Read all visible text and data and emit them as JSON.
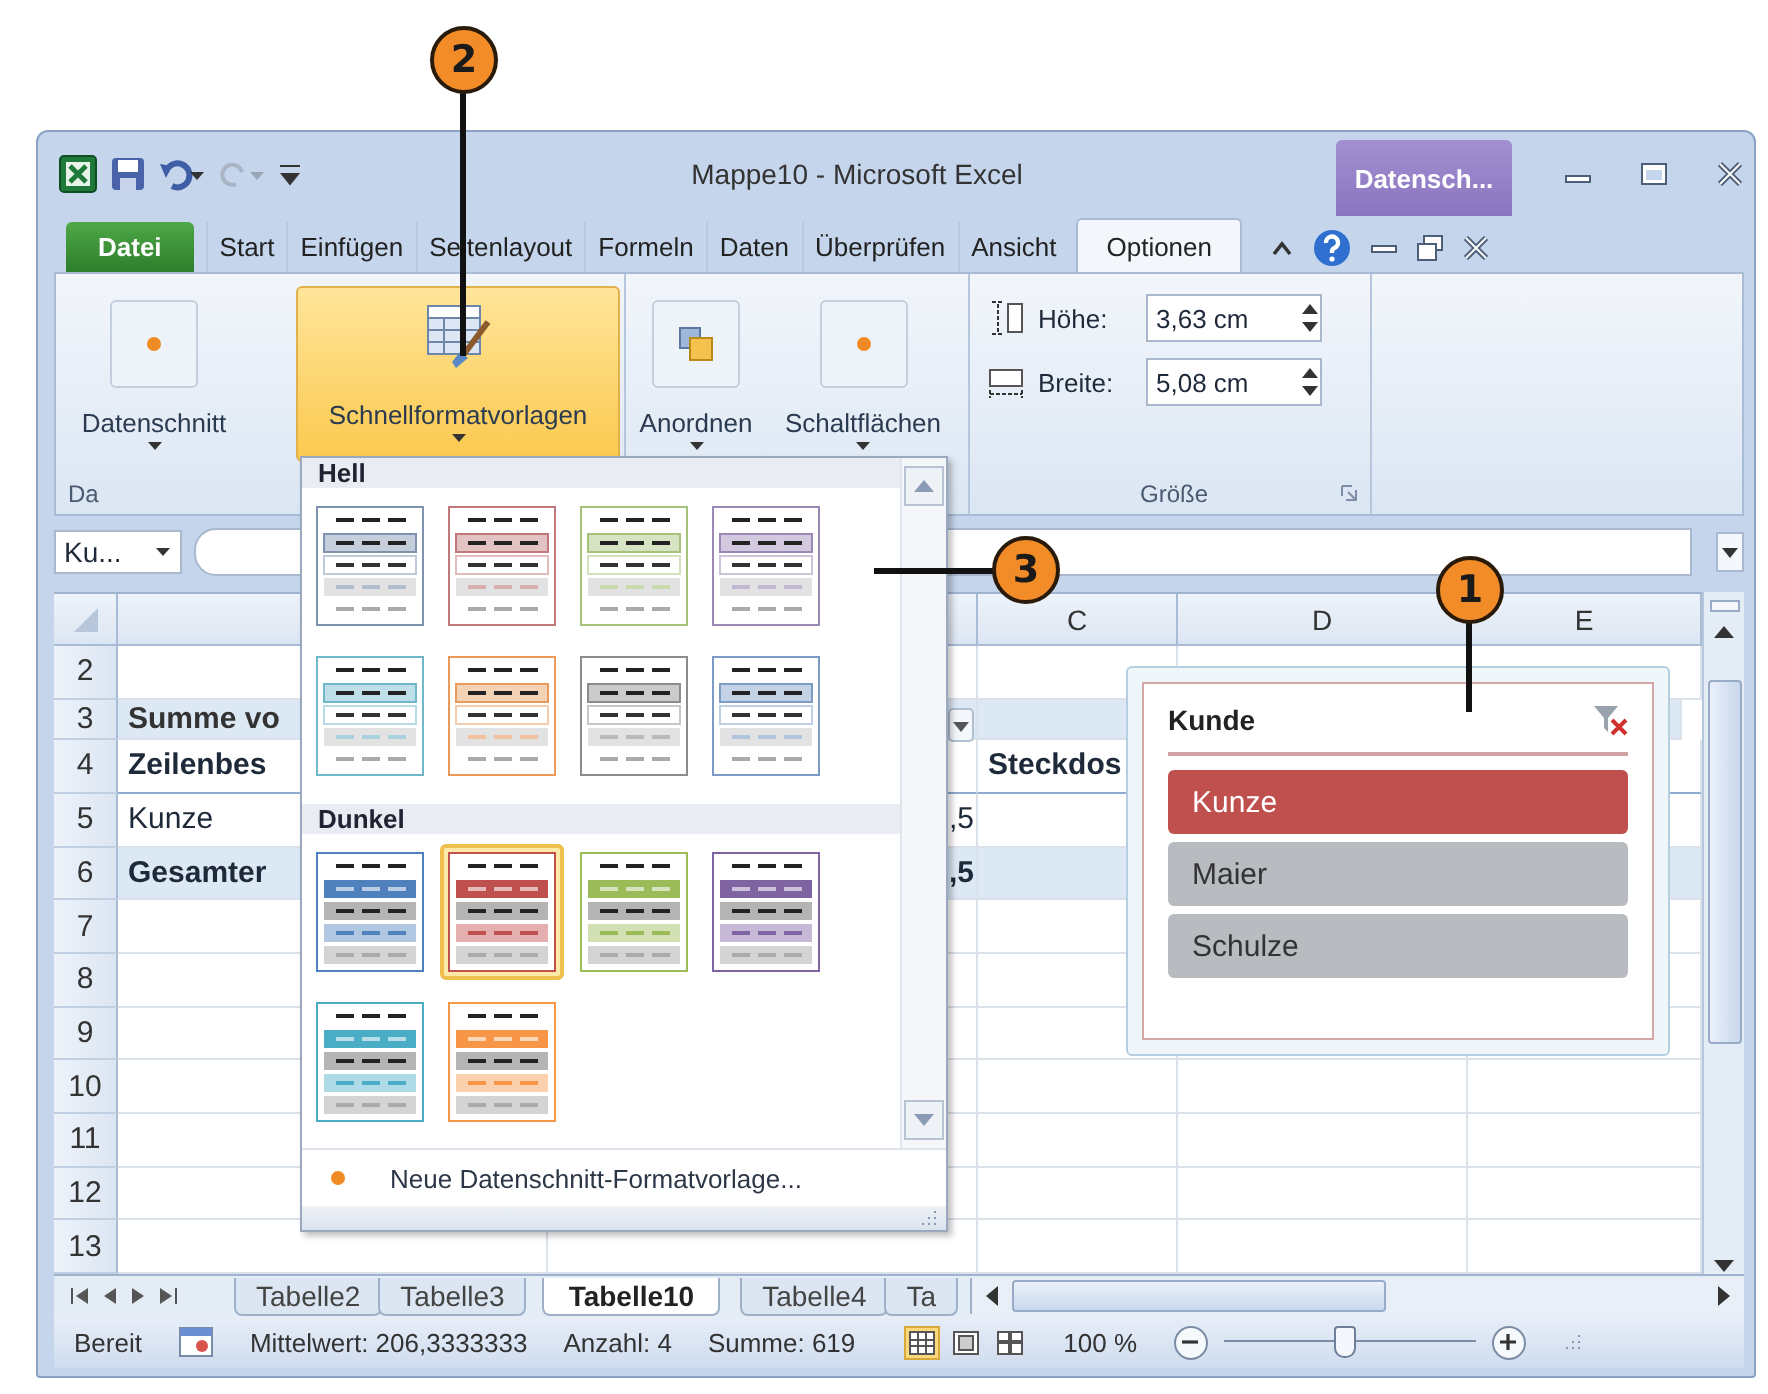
{
  "window": {
    "title": "Mappe10 - Microsoft Excel",
    "context_tab": "Datensch..."
  },
  "tabs": [
    {
      "label": "Datei",
      "kind": "file",
      "selected": false
    },
    {
      "label": "Start",
      "kind": "tab",
      "selected": false
    },
    {
      "label": "Einfügen",
      "kind": "tab",
      "selected": false
    },
    {
      "label": "Seitenlayout",
      "kind": "tab",
      "selected": false
    },
    {
      "label": "Formeln",
      "kind": "tab",
      "selected": false
    },
    {
      "label": "Daten",
      "kind": "tab",
      "selected": false
    },
    {
      "label": "Überprüfen",
      "kind": "tab",
      "selected": false
    },
    {
      "label": "Ansicht",
      "kind": "tab",
      "selected": false
    },
    {
      "label": "Optionen",
      "kind": "tab",
      "selected": true
    }
  ],
  "ribbon": {
    "groups": [
      {
        "label": "Da",
        "buttons": [
          {
            "label": "Datenschnitt",
            "kind": "dot",
            "selected": false
          },
          {
            "label": "Schnellformatvorlagen",
            "kind": "styles",
            "selected": true
          }
        ]
      },
      {
        "buttons": [
          {
            "label": "Anordnen",
            "kind": "arrange",
            "selected": false
          },
          {
            "label": "Schaltflächen",
            "kind": "dot",
            "selected": false
          }
        ]
      }
    ],
    "size_group": {
      "label": "Größe",
      "fields": [
        {
          "kind": "height",
          "label": "Höhe:",
          "value": "3,63 cm"
        },
        {
          "kind": "width",
          "label": "Breite:",
          "value": "5,08 cm"
        }
      ]
    }
  },
  "name_box": {
    "value": "Ku..."
  },
  "grid": {
    "columns": [
      {
        "label": "C"
      },
      {
        "label": "D"
      },
      {
        "label": "E"
      }
    ],
    "rows": [
      {
        "number": "2",
        "kind": "empty"
      },
      {
        "number": "3",
        "kind": "title",
        "filter": true,
        "column_a": "Summe vo"
      },
      {
        "number": "4",
        "kind": "header",
        "column_a": "Zeilenbes",
        "column_c": "Steckdos"
      },
      {
        "number": "5",
        "kind": "item",
        "column_a": "Kunze",
        "column_b": ",5"
      },
      {
        "number": "6",
        "kind": "total",
        "column_a": "Gesamter",
        "column_b": ",5"
      },
      {
        "number": "7",
        "kind": "empty"
      },
      {
        "number": "8",
        "kind": "empty"
      },
      {
        "number": "9",
        "kind": "empty"
      },
      {
        "number": "10",
        "kind": "empty"
      },
      {
        "number": "11",
        "kind": "empty"
      },
      {
        "number": "12",
        "kind": "empty"
      },
      {
        "number": "13",
        "kind": "empty"
      }
    ]
  },
  "gallery": {
    "sections": [
      {
        "title": "Hell",
        "kind": "light",
        "styles": [
          {
            "color": "#7f93b0",
            "selected": false
          },
          {
            "color": "#c0787a",
            "selected": false
          },
          {
            "color": "#a6c27a",
            "selected": false
          },
          {
            "color": "#9a88b5",
            "selected": false
          },
          {
            "color": "#6fb7c9",
            "selected": false
          },
          {
            "color": "#e79a5c",
            "selected": false
          },
          {
            "color": "#8c8c8c",
            "selected": false
          },
          {
            "color": "#7c9cc6",
            "selected": false
          }
        ]
      },
      {
        "title": "Dunkel",
        "kind": "dark",
        "styles": [
          {
            "color": "#4f81bd",
            "selected": false
          },
          {
            "color": "#c0504d",
            "selected": true
          },
          {
            "color": "#9bbb59",
            "selected": false
          },
          {
            "color": "#8064a2",
            "selected": false
          },
          {
            "color": "#4bacc6",
            "selected": false
          },
          {
            "color": "#f79646",
            "selected": false
          }
        ]
      }
    ],
    "footer": "Neue Datenschnitt-Formatvorlage..."
  },
  "slicer": {
    "title": "Kunde",
    "items": [
      {
        "label": "Kunze",
        "selected": true
      },
      {
        "label": "Maier",
        "selected": false
      },
      {
        "label": "Schulze",
        "selected": false
      }
    ]
  },
  "sheet_tabs": [
    {
      "label": "Tabelle2",
      "selected": false
    },
    {
      "label": "Tabelle3",
      "selected": false
    },
    {
      "label": "Tabelle10",
      "selected": true
    },
    {
      "label": "Tabelle4",
      "selected": false
    },
    {
      "label": "Ta",
      "selected": false
    }
  ],
  "status_bar": {
    "mode": "Bereit",
    "stats": [
      "Mittelwert: 206,3333333",
      "Anzahl: 4",
      "Summe: 619"
    ],
    "views": [
      {
        "kind": "normal",
        "selected": true
      },
      {
        "kind": "layout",
        "selected": false
      },
      {
        "kind": "pagebreak",
        "selected": false
      }
    ],
    "zoom": "100 %",
    "zoom_slider": {
      "level": 0.48
    }
  },
  "callouts": [
    {
      "label": "2",
      "kind": "down"
    },
    {
      "label": "3",
      "kind": "left"
    },
    {
      "label": "1",
      "kind": "down"
    }
  ]
}
